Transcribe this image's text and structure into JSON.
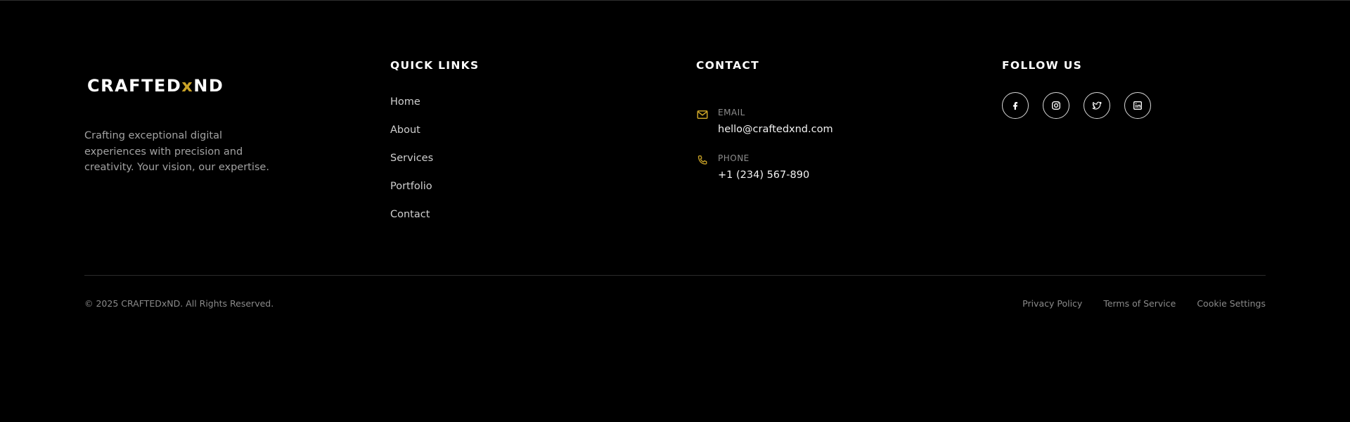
{
  "brand": {
    "logo_text_left": "CRAFTED",
    "logo_text_x": "x",
    "logo_text_right": "ND",
    "tagline": "Crafting exceptional digital experiences with precision and creativity. Your vision, our expertise.",
    "accent_color": "#c9a227"
  },
  "quick_links": {
    "heading": "QUICK LINKS",
    "items": [
      {
        "label": "Home"
      },
      {
        "label": "About"
      },
      {
        "label": "Services"
      },
      {
        "label": "Portfolio"
      },
      {
        "label": "Contact"
      }
    ]
  },
  "contact": {
    "heading": "CONTACT",
    "email": {
      "label": "EMAIL",
      "value": "hello@craftedxnd.com",
      "icon": "mail-icon"
    },
    "phone": {
      "label": "PHONE",
      "value": "+1 (234) 567-890",
      "icon": "phone-icon"
    }
  },
  "social": {
    "heading": "FOLLOW US",
    "items": [
      {
        "icon": "facebook-icon"
      },
      {
        "icon": "instagram-icon"
      },
      {
        "icon": "twitter-icon"
      },
      {
        "icon": "linkedin-icon"
      }
    ]
  },
  "bottom": {
    "copyright": "© 2025 CRAFTEDxND. All Rights Reserved.",
    "legal_links": [
      {
        "label": "Privacy Policy"
      },
      {
        "label": "Terms of Service"
      },
      {
        "label": "Cookie Settings"
      }
    ]
  }
}
